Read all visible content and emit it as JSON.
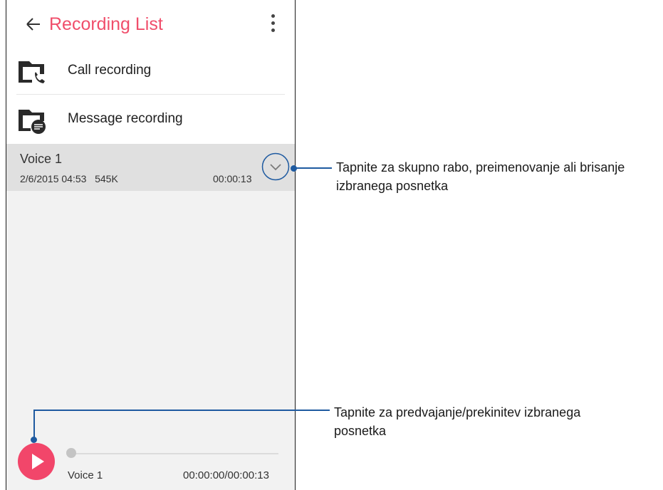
{
  "app": {
    "title": "Recording List",
    "back_icon": "arrow-left-icon",
    "menu_icon": "more-vert-icon",
    "accent_color": "#f04e6b"
  },
  "categories": [
    {
      "label": "Call recording",
      "icon": "folder-phone-icon"
    },
    {
      "label": "Message recording",
      "icon": "folder-message-icon"
    }
  ],
  "recordings": [
    {
      "name": "Voice 1",
      "date": "2/6/2015 04:53",
      "size": "545K",
      "duration": "00:00:13",
      "expand_icon": "chevron-down-icon"
    }
  ],
  "player": {
    "track_name": "Voice 1",
    "time": "00:00:00/00:00:13",
    "progress": 0,
    "play_icon": "play-icon",
    "play_color": "#f2466a"
  },
  "callouts": {
    "expand": {
      "line1": "Tapnite za skupno rabo, preimenovanje ali brisanje",
      "line2": "izbranega posnetka"
    },
    "play": {
      "line1": "Tapnite za predvajanje/prekinitev izbranega",
      "line2": "posnetka"
    },
    "color": "#1e5aa0"
  }
}
